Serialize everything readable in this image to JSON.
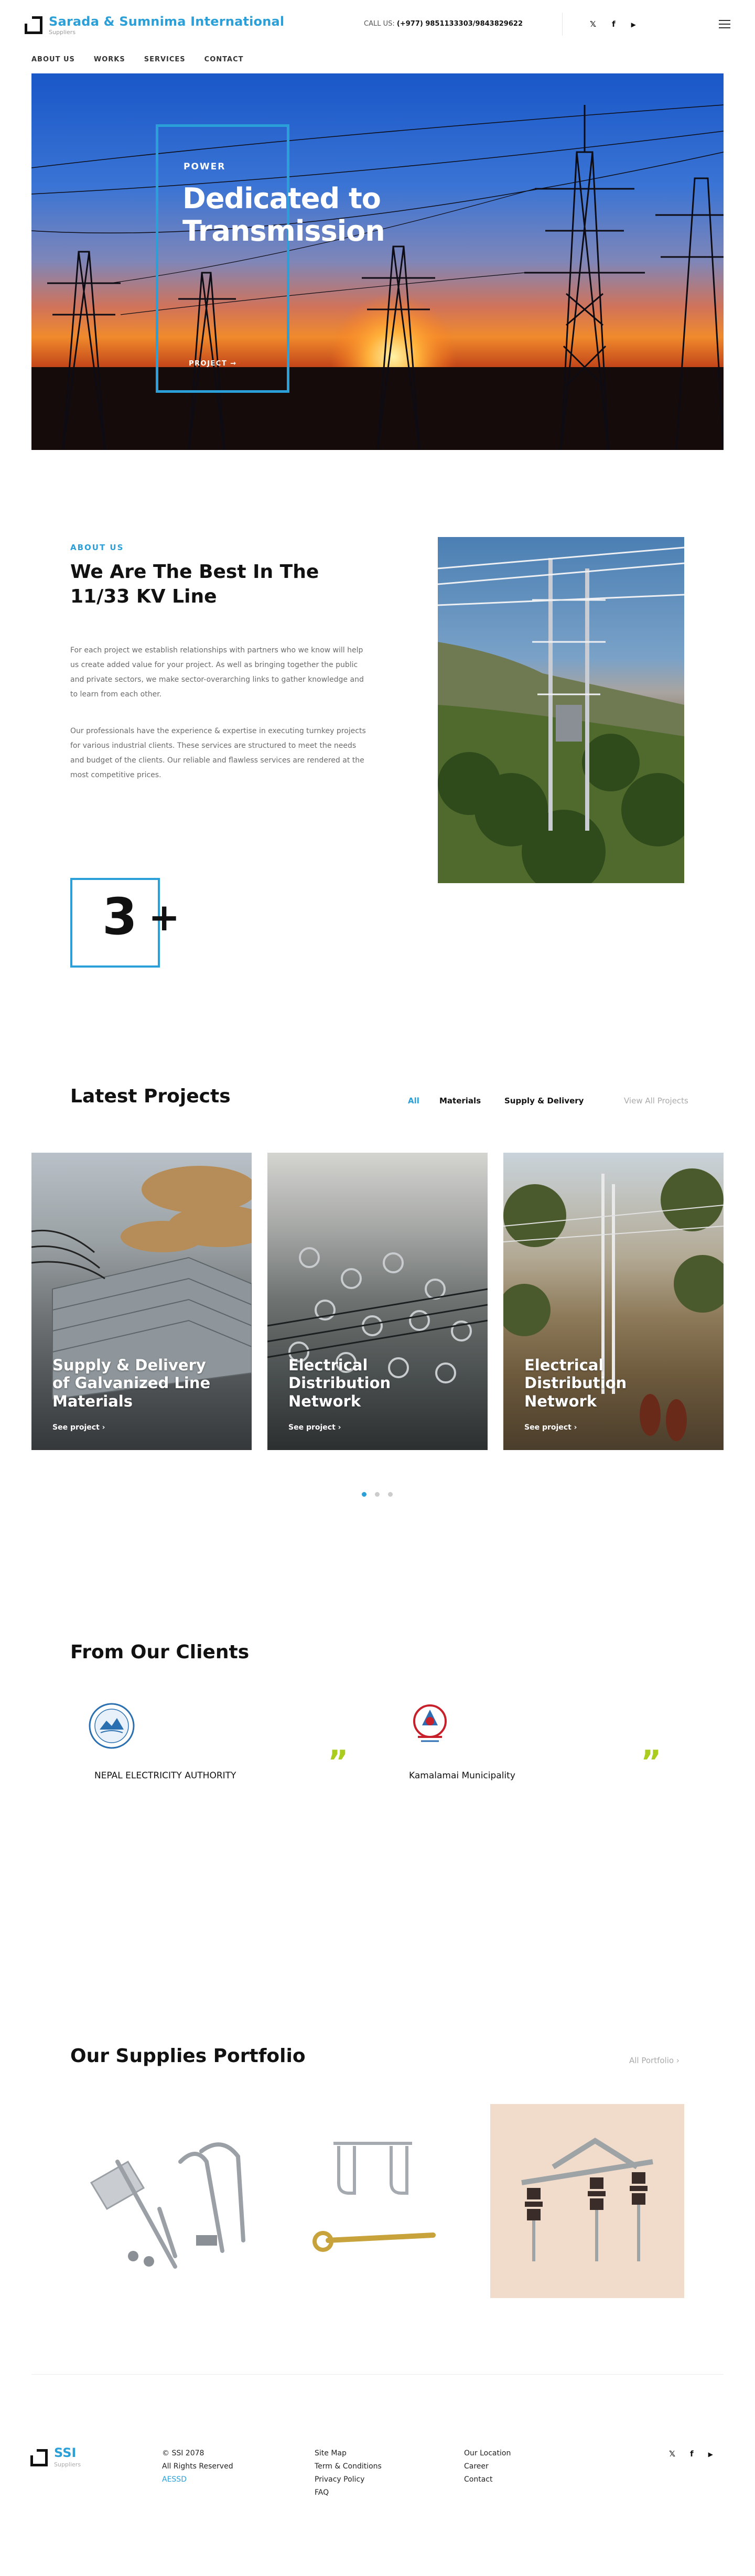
{
  "header": {
    "brand_name": "Sarada & Sumnima International",
    "brand_sub": "Suppliers",
    "call_label": "CALL US:",
    "call_numbers": "(+977) 9851133303/9843829622",
    "social": [
      "twitter-icon",
      "facebook-icon",
      "youtube-icon"
    ],
    "social_glyphs": [
      "𝕏",
      "f",
      "▶"
    ],
    "menu_icon": "hamburger-menu-icon"
  },
  "nav": {
    "items": [
      "ABOUT US",
      "WORKS",
      "SERVICES",
      "CONTACT"
    ]
  },
  "hero": {
    "kicker": "POWER",
    "title": "Dedicated to Transmission",
    "link": "PROJECT →"
  },
  "about": {
    "kicker": "ABOUT US",
    "title": "We Are The Best In The 11/33 KV Line",
    "paragraph1": "For each project we establish relationships with partners who we know will help us create added value for your project. As well as bringing together the public and private sectors, we make sector-overarching links to gather knowledge and to learn from each other.",
    "paragraph2": "Our professionals have the experience & expertise in executing turnkey projects for various industrial clients. These services are structured to meet the needs and budget of the clients. Our reliable and flawless services are rendered at the most competitive prices.",
    "counter_value": "3",
    "counter_suffix": "+"
  },
  "projects": {
    "title": "Latest Projects",
    "filters": [
      "All",
      "Materials",
      "Supply & Delivery"
    ],
    "active_filter": "All",
    "view_all": "View All Projects",
    "cards": [
      {
        "title": "Supply & Delivery of Galvanized Line Materials",
        "link": "See project  ›"
      },
      {
        "title": "Electrical Distribution Network",
        "link": "See project  ›"
      },
      {
        "title": "Electrical Distribution Network",
        "link": "See project  ›"
      }
    ],
    "pagination_active": 1,
    "pagination_total": 3
  },
  "clients": {
    "title": "From Our Clients",
    "items": [
      {
        "name": "NEPAL ELECTRICITY AUTHORITY",
        "logo_icon": "nea-logo-icon"
      },
      {
        "name": "Kamalamai Municipality",
        "logo_icon": "nepal-emblem-icon"
      }
    ],
    "quote_glyph": "”"
  },
  "supplies": {
    "title": "Our Supplies Portfolio",
    "all_link": "All Portfolio  ›"
  },
  "footer": {
    "brand_name": "SSI",
    "brand_sub": "Suppliers",
    "col1": [
      "© SSI 2078",
      "All Rights Reserved",
      "AESSD"
    ],
    "col2": [
      "Site Map",
      "Term & Conditions",
      "Privacy Policy",
      "FAQ"
    ],
    "col3": [
      "Our Location",
      "Career",
      "Contact"
    ],
    "social_glyphs": [
      "𝕏",
      "f",
      "▶"
    ]
  },
  "colors": {
    "accent": "#2a9fd8",
    "quote": "#a9cc1e",
    "text": "#111111",
    "muted": "#6b6b6b"
  }
}
